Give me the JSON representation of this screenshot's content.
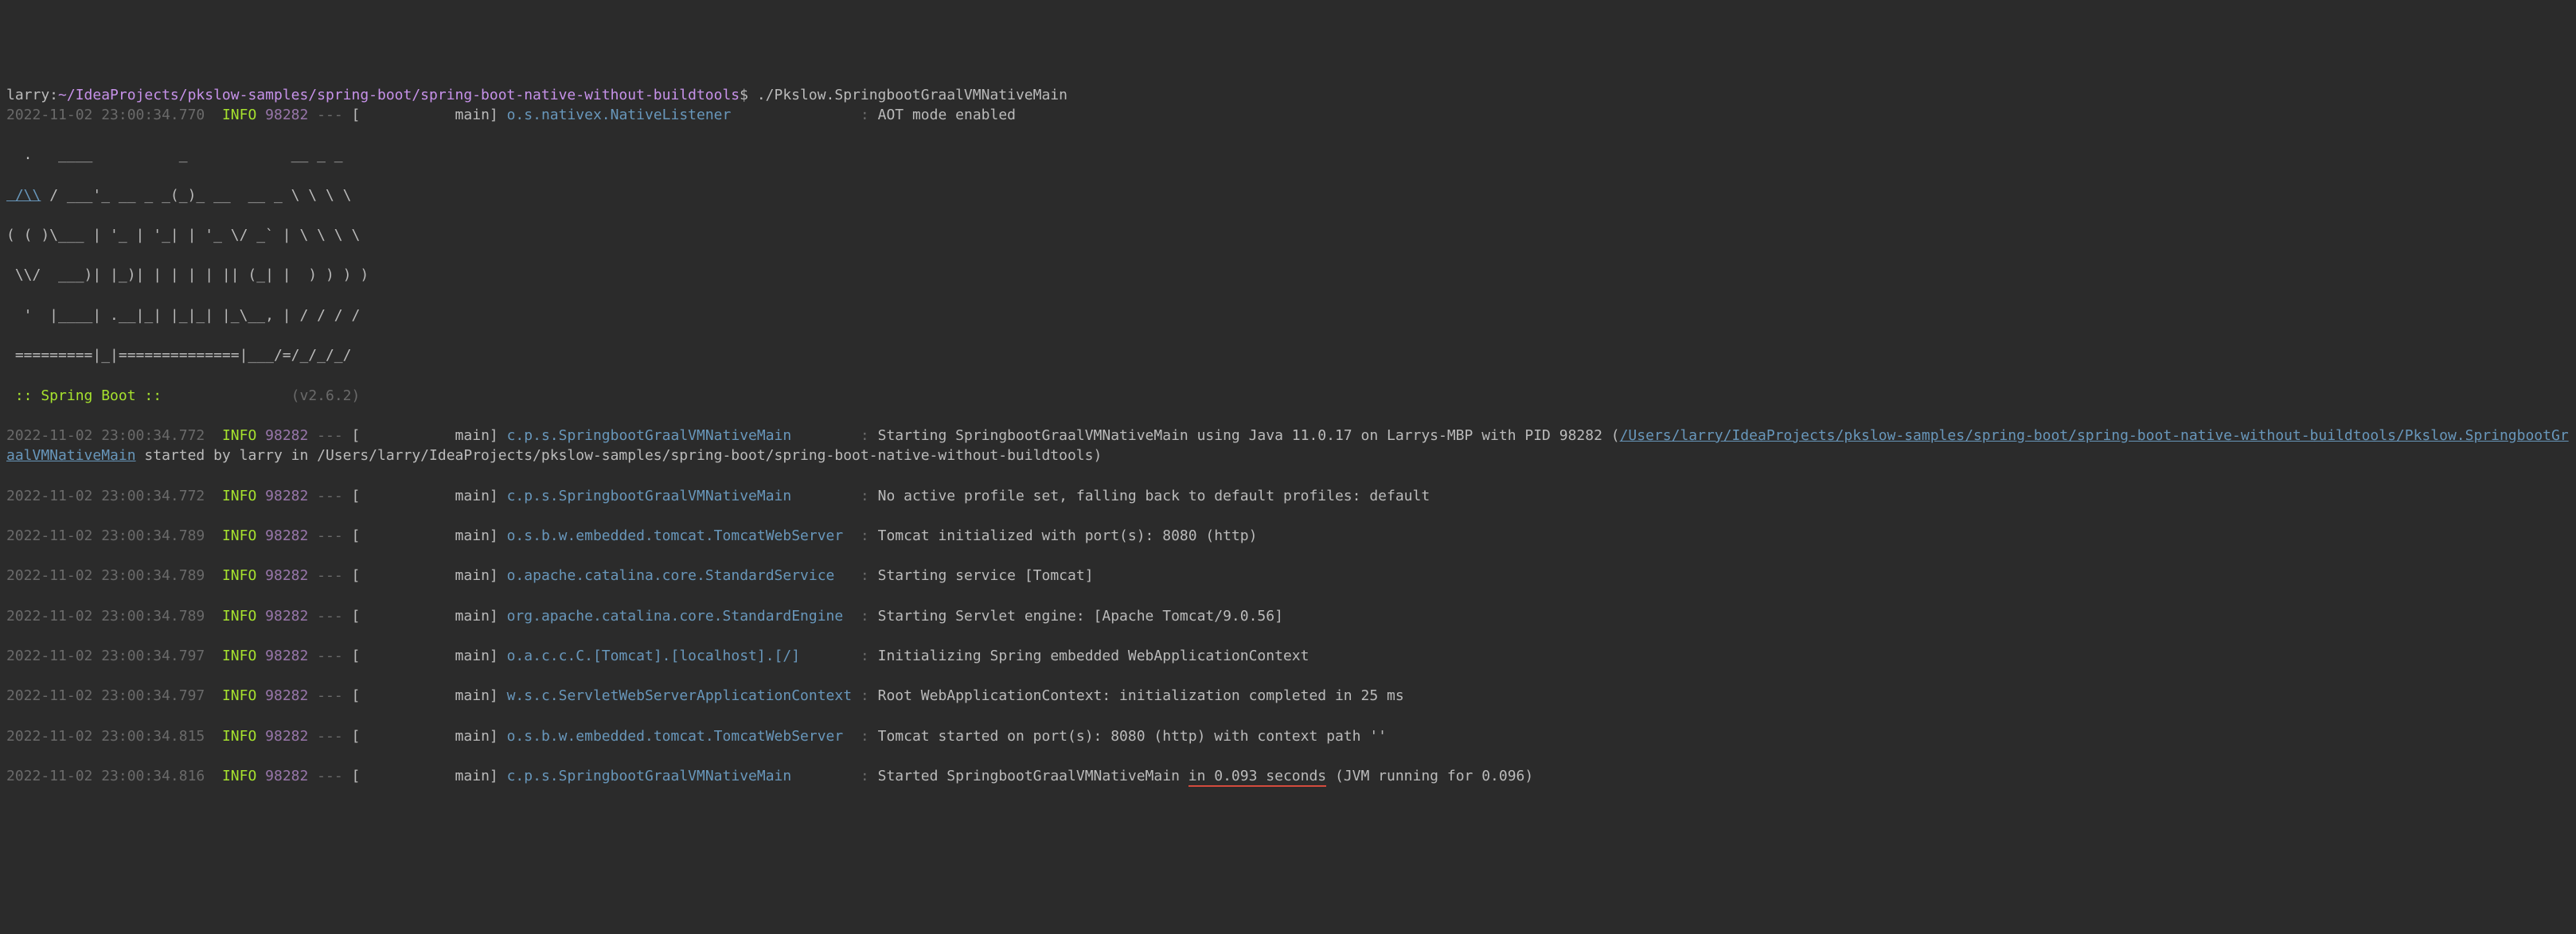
{
  "prompt": {
    "user": "larry:",
    "path": "~/IdeaProjects/pkslow-samples/spring-boot/spring-boot-native-without-buildtools",
    "dollar": "$",
    "command": " ./Pkslow.SpringbootGraalVMNativeMain"
  },
  "banner": {
    "l1": "  .   ____          _            __ _ _",
    "l2_link": " /\\\\",
    "l2_rest": " / ___'_ __ _ _(_)_ __  __ _ \\ \\ \\ \\",
    "l3": "( ( )\\___ | '_ | '_| | '_ \\/ _` | \\ \\ \\ \\",
    "l4": " \\\\/  ___)| |_)| | | | | || (_| |  ) ) ) )",
    "l5": "  '  |____| .__|_| |_|_| |_\\__, | / / / /",
    "l6": " =========|_|==============|___/=/_/_/_/",
    "label": " :: Spring Boot ::",
    "spacer": "               ",
    "version": "(v2.6.2)"
  },
  "lines": [
    {
      "ts": "2022-11-02 23:00:34.770",
      "level": "INFO",
      "pid": "98282",
      "thread": "[           main]",
      "logger": "o.s.nativex.NativeListener              ",
      "msg": "AOT mode enabled"
    },
    {
      "ts": "2022-11-02 23:00:34.772",
      "level": "INFO",
      "pid": "98282",
      "thread": "[           main]",
      "logger": "c.p.s.SpringbootGraalVMNativeMain       ",
      "msg_pre": "Starting SpringbootGraalVMNativeMain using Java 11.0.17 on Larrys-MBP with PID 98282 (",
      "msg_link": "/Users/larry/IdeaProjects/pkslow-samples/spring-boot/spring-boot-native-without-buildtools/Pkslow.SpringbootGraalVMNativeMain",
      "msg_post": " started by larry in /Users/larry/IdeaProjects/pkslow-samples/spring-boot/spring-boot-native-without-buildtools)"
    },
    {
      "ts": "2022-11-02 23:00:34.772",
      "level": "INFO",
      "pid": "98282",
      "thread": "[           main]",
      "logger": "c.p.s.SpringbootGraalVMNativeMain       ",
      "msg": "No active profile set, falling back to default profiles: default"
    },
    {
      "ts": "2022-11-02 23:00:34.789",
      "level": "INFO",
      "pid": "98282",
      "thread": "[           main]",
      "logger": "o.s.b.w.embedded.tomcat.TomcatWebServer ",
      "msg": "Tomcat initialized with port(s): 8080 (http)"
    },
    {
      "ts": "2022-11-02 23:00:34.789",
      "level": "INFO",
      "pid": "98282",
      "thread": "[           main]",
      "logger": "o.apache.catalina.core.StandardService  ",
      "msg": "Starting service [Tomcat]"
    },
    {
      "ts": "2022-11-02 23:00:34.789",
      "level": "INFO",
      "pid": "98282",
      "thread": "[           main]",
      "logger": "org.apache.catalina.core.StandardEngine ",
      "msg": "Starting Servlet engine: [Apache Tomcat/9.0.56]"
    },
    {
      "ts": "2022-11-02 23:00:34.797",
      "level": "INFO",
      "pid": "98282",
      "thread": "[           main]",
      "logger": "o.a.c.c.C.[Tomcat].[localhost].[/]      ",
      "msg": "Initializing Spring embedded WebApplicationContext"
    },
    {
      "ts": "2022-11-02 23:00:34.797",
      "level": "INFO",
      "pid": "98282",
      "thread": "[           main]",
      "logger": "w.s.c.ServletWebServerApplicationContext",
      "msg": "Root WebApplicationContext: initialization completed in 25 ms"
    },
    {
      "ts": "2022-11-02 23:00:34.815",
      "level": "INFO",
      "pid": "98282",
      "thread": "[           main]",
      "logger": "o.s.b.w.embedded.tomcat.TomcatWebServer ",
      "msg": "Tomcat started on port(s): 8080 (http) with context path ''"
    },
    {
      "ts": "2022-11-02 23:00:34.816",
      "level": "INFO",
      "pid": "98282",
      "thread": "[           main]",
      "logger": "c.p.s.SpringbootGraalVMNativeMain       ",
      "msg_pre2": "Started SpringbootGraalVMNativeMain ",
      "msg_u": "in 0.093 seconds",
      "msg_post2": " (JVM running for 0.096)"
    }
  ],
  "sep": " --- "
}
